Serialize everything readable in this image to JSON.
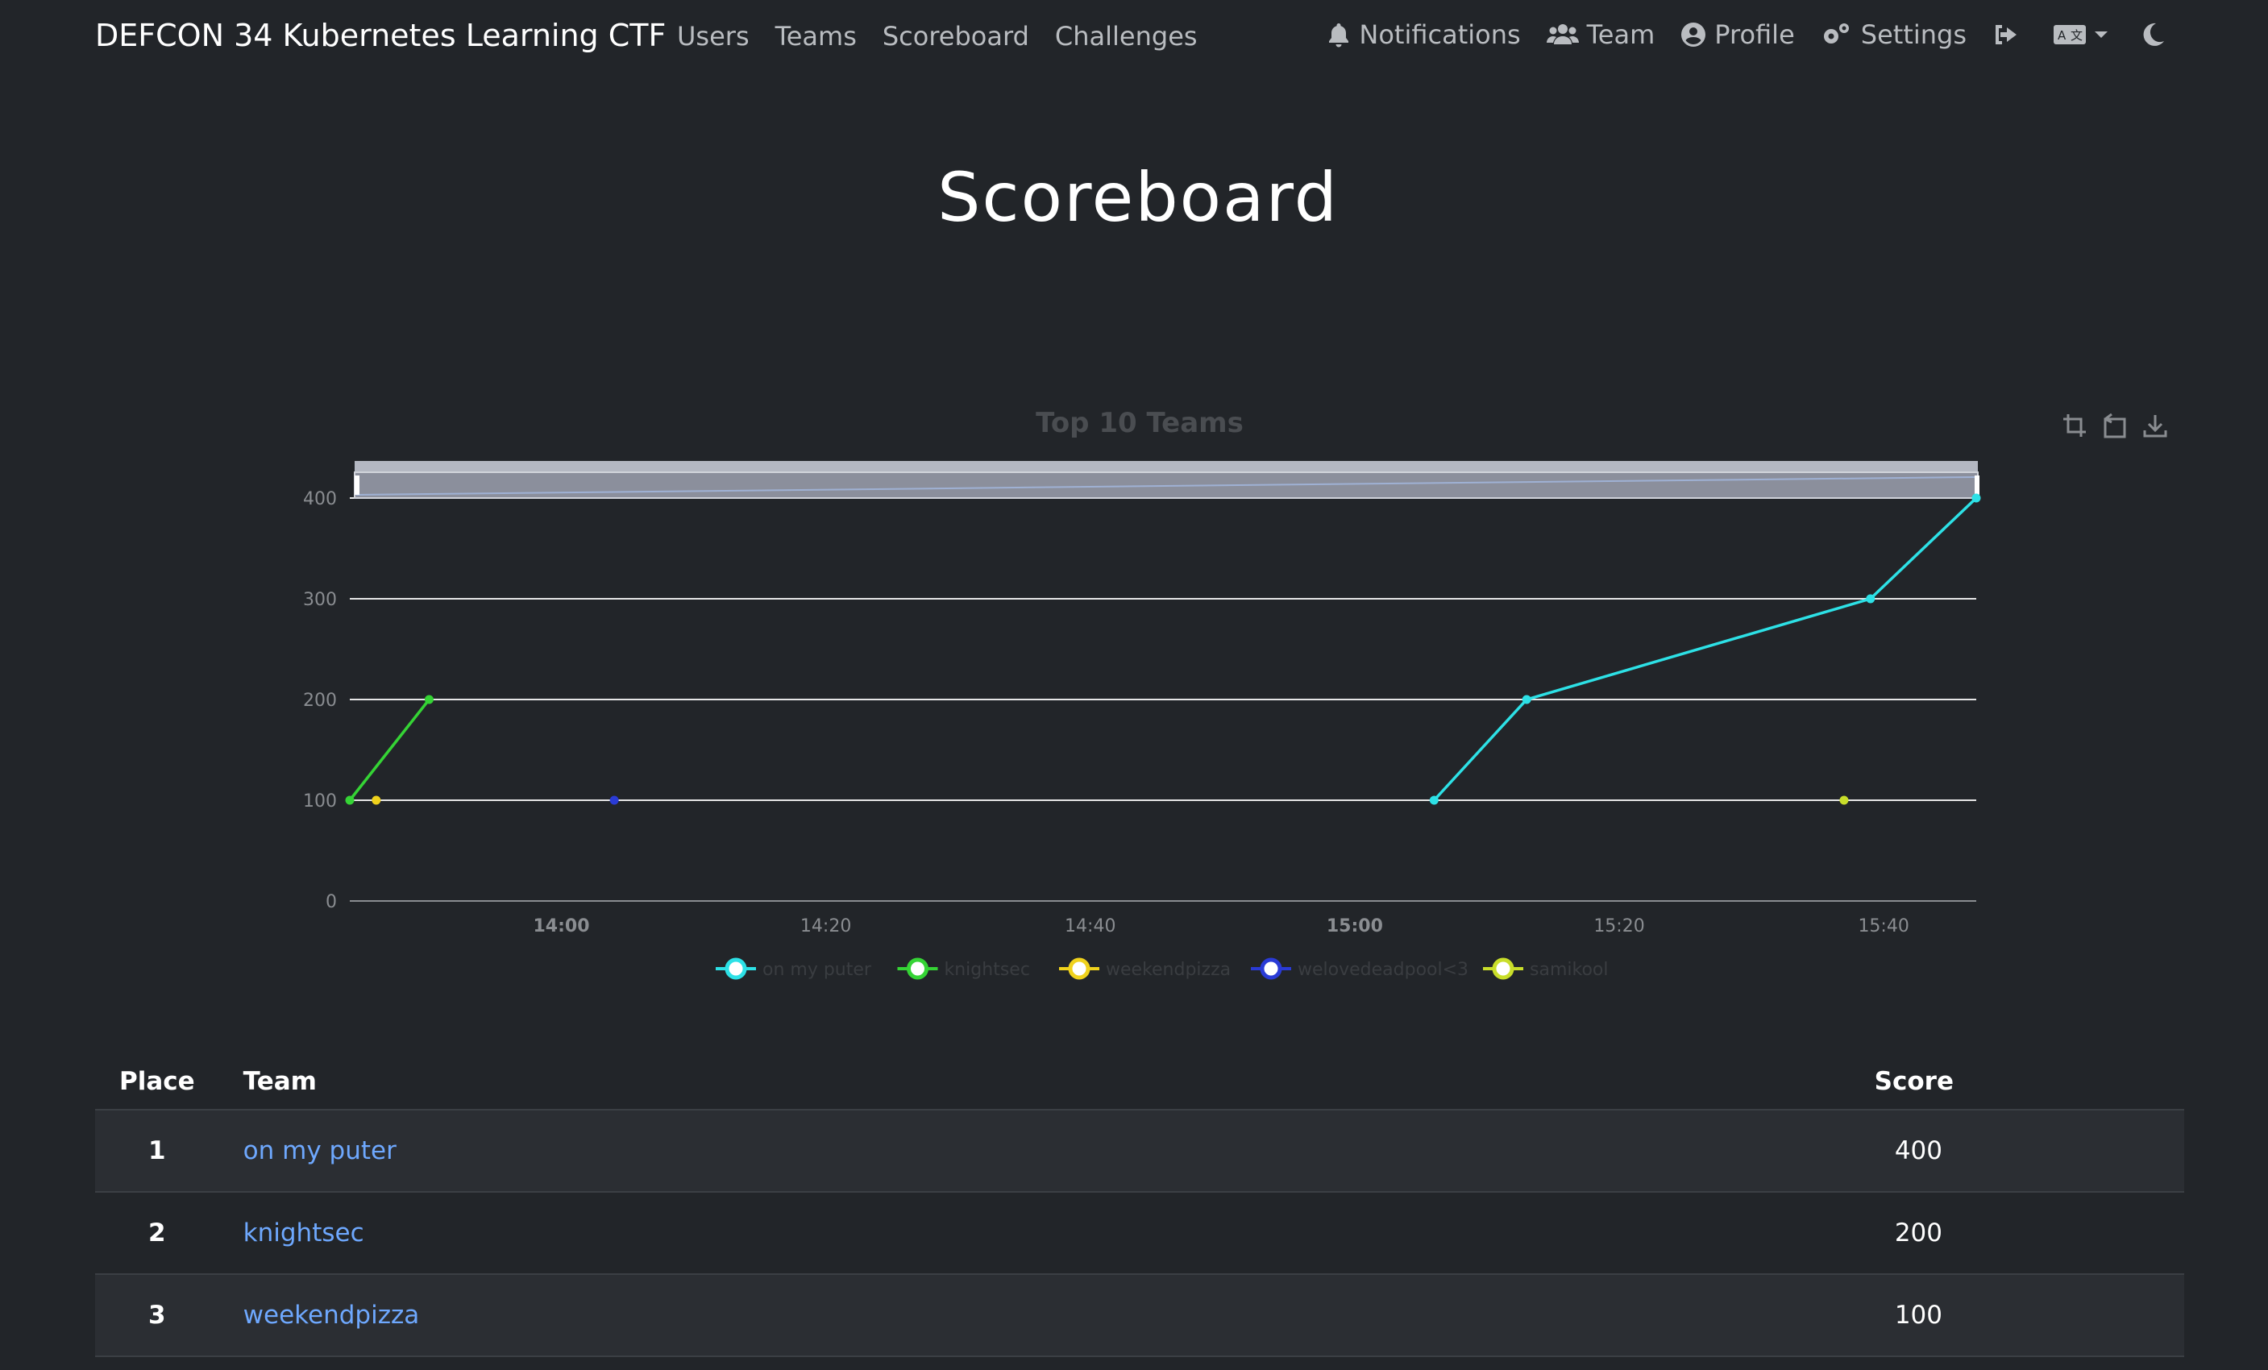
{
  "navbar": {
    "brand": "DEFCON 34 Kubernetes Learning CTF",
    "left_links": [
      "Users",
      "Teams",
      "Scoreboard",
      "Challenges"
    ],
    "right_links": {
      "notifications": "Notifications",
      "team": "Team",
      "profile": "Profile",
      "settings": "Settings"
    }
  },
  "page": {
    "title": "Scoreboard"
  },
  "chart_data": {
    "type": "line",
    "title": "Top 10 Teams",
    "xlabel": "",
    "ylabel": "",
    "ylim": [
      0,
      400
    ],
    "yticks": [
      0,
      100,
      200,
      300,
      400
    ],
    "xlim": [
      "13:44",
      "15:47"
    ],
    "xticks": [
      {
        "label": "14:00",
        "bold": true
      },
      {
        "label": "14:20",
        "bold": false
      },
      {
        "label": "14:40",
        "bold": false
      },
      {
        "label": "15:00",
        "bold": true
      },
      {
        "label": "15:20",
        "bold": false
      },
      {
        "label": "15:40",
        "bold": false
      }
    ],
    "grid": true,
    "legend": "bottom",
    "series": [
      {
        "name": "on my puter",
        "color": "#2de1e6",
        "points": [
          [
            "15:06",
            100
          ],
          [
            "15:13",
            200
          ],
          [
            "15:39",
            300
          ],
          [
            "15:47",
            400
          ]
        ]
      },
      {
        "name": "knightsec",
        "color": "#35d435",
        "points": [
          [
            "13:44",
            100
          ],
          [
            "13:50",
            200
          ]
        ]
      },
      {
        "name": "weekendpizza",
        "color": "#f0d21c",
        "points": [
          [
            "13:46",
            100
          ]
        ]
      },
      {
        "name": "welovedeadpool<3",
        "color": "#2a3bd6",
        "points": [
          [
            "14:04",
            100
          ]
        ]
      },
      {
        "name": "samikool",
        "color": "#c9de2a",
        "points": [
          [
            "15:37",
            100
          ]
        ]
      }
    ]
  },
  "table": {
    "headers": {
      "place": "Place",
      "team": "Team",
      "score": "Score"
    },
    "rows": [
      {
        "place": "1",
        "team": "on my puter",
        "score": "400"
      },
      {
        "place": "2",
        "team": "knightsec",
        "score": "200"
      },
      {
        "place": "3",
        "team": "weekendpizza",
        "score": "100"
      }
    ]
  }
}
